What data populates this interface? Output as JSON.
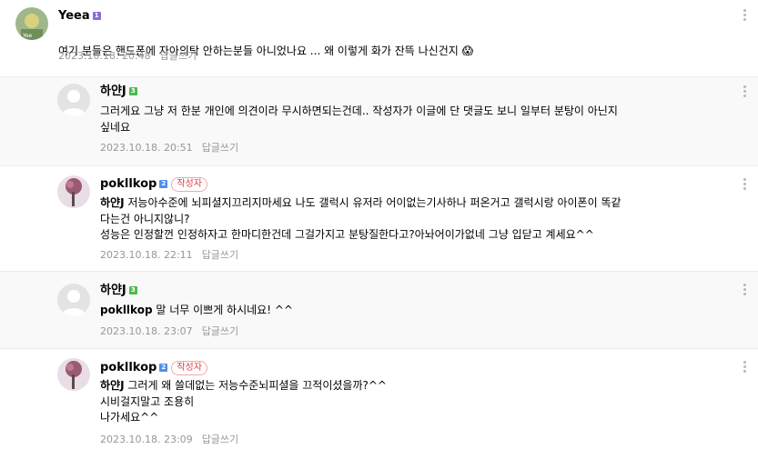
{
  "comments": [
    {
      "nick": "Yeea",
      "level": "1",
      "text": "여기 분들은 핸드폰에 자아의탁 안하는분들 아니었나요 ... 왜 이렇게 화가 잔뜩 나신건지",
      "emoji": "😱",
      "date": "2023.10.18. 20:48",
      "reply_label": "답글쓰기"
    },
    {
      "nick": "하얀J",
      "level": "3",
      "text": "그러게요 그냥 저 한분 개인에 의견이라 무시하면되는건데.. 작성자가 이글에 단 댓글도 보니 일부터 분탕이 아닌지\n싶네요",
      "date": "2023.10.18. 20:51",
      "reply_label": "답글쓰기"
    },
    {
      "nick": "pokllkop",
      "level": "2",
      "author_tag": "작성자",
      "mention": "하얀J",
      "text": " 저능아수준에 뇌피셜지끄리지마세요 나도 갤럭시 유저라 어이없는기사하나 퍼온거고 갤럭시랑 아이폰이 똑같\n다는건 아니지않니?\n성능은 인정할껀 인정하자고 한마디한건데 그걸가지고 분탕질한다고?아놔어이가없네 그냥 입닫고 계세요^^",
      "date": "2023.10.18. 22:11",
      "reply_label": "답글쓰기"
    },
    {
      "nick": "하얀J",
      "level": "3",
      "mention": "pokllkop",
      "text": " 말 너무 이쁘게 하시네요! ^^",
      "date": "2023.10.18. 23:07",
      "reply_label": "답글쓰기"
    },
    {
      "nick": "pokllkop",
      "level": "2",
      "author_tag": "작성자",
      "mention": "하얀J",
      "text": " 그러게 왜 쓸데없는 저능수준뇌피셜을 끄적이셨을까?^^\n시비걸지말고 조용히\n나가세요^^",
      "date": "2023.10.18. 23:09",
      "reply_label": "답글쓰기"
    }
  ]
}
